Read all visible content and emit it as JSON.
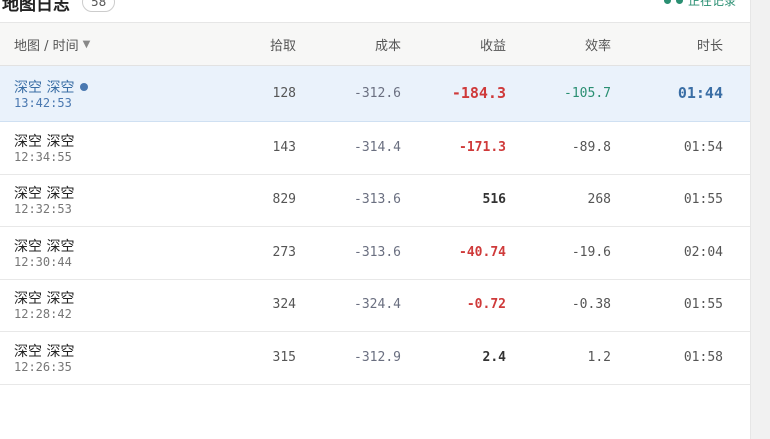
{
  "header": {
    "title": "地图日志",
    "count": "58",
    "recording_label": "正在记录"
  },
  "columns": {
    "map_time": "地图 / 时间",
    "pick": "拾取",
    "cost": "成本",
    "profit": "收益",
    "efficiency": "效率",
    "duration": "时长"
  },
  "rows": [
    {
      "map": "深空 深空",
      "time": "13:42:53",
      "pick": "128",
      "cost": "-312.6",
      "profit": "-184.3",
      "efficiency": "-105.7",
      "duration": "01:44",
      "current": true
    },
    {
      "map": "深空 深空",
      "time": "12:34:55",
      "pick": "143",
      "cost": "-314.4",
      "profit": "-171.3",
      "efficiency": "-89.8",
      "duration": "01:54"
    },
    {
      "map": "深空 深空",
      "time": "12:32:53",
      "pick": "829",
      "cost": "-313.6",
      "profit": "516",
      "efficiency": "268",
      "duration": "01:55"
    },
    {
      "map": "深空 深空",
      "time": "12:30:44",
      "pick": "273",
      "cost": "-313.6",
      "profit": "-40.74",
      "efficiency": "-19.6",
      "duration": "02:04"
    },
    {
      "map": "深空 深空",
      "time": "12:28:42",
      "pick": "324",
      "cost": "-324.4",
      "profit": "-0.72",
      "efficiency": "-0.38",
      "duration": "01:55"
    },
    {
      "map": "深空 深空",
      "time": "12:26:35",
      "pick": "315",
      "cost": "-312.9",
      "profit": "2.4",
      "efficiency": "1.2",
      "duration": "01:58"
    }
  ],
  "colors": {
    "negative": "#cf3a3a",
    "teal": "#2a8f72",
    "accent_blue": "#3a6ea5",
    "active_row_bg": "#eaf2fb"
  }
}
